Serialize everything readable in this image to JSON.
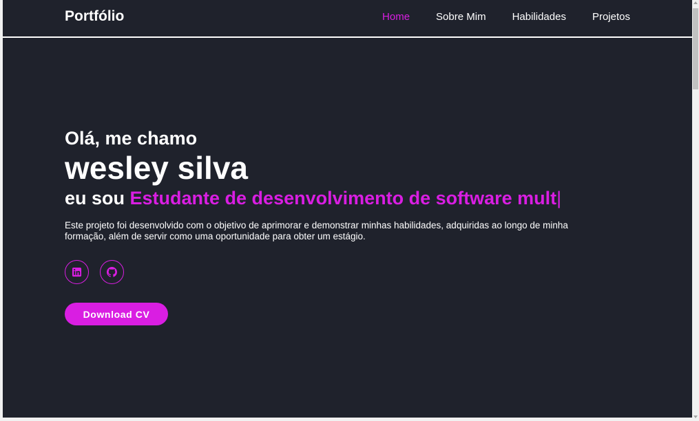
{
  "nav": {
    "brand": "Portfólio",
    "links": [
      {
        "label": "Home",
        "active": true
      },
      {
        "label": "Sobre Mim",
        "active": false
      },
      {
        "label": "Habilidades",
        "active": false
      },
      {
        "label": "Projetos",
        "active": false
      }
    ]
  },
  "hero": {
    "greeting": "Olá, me chamo",
    "name": "wesley silva",
    "role_prefix": "eu sou",
    "role_typed": "Estudante de desenvolvimento de software mult",
    "cursor": "|",
    "bio": "Este projeto foi desenvolvido com o objetivo de aprimorar e demonstrar minhas habilidades, adquiridas ao longo de minha formação, além de servir como uma oportunidade para obter um estágio.",
    "socials": [
      {
        "icon": "linkedin-icon"
      },
      {
        "icon": "github-icon"
      }
    ],
    "cv_button": "Download CV"
  },
  "colors": {
    "background": "#1f222c",
    "accent": "#d91ee2",
    "text": "#ffffff"
  }
}
